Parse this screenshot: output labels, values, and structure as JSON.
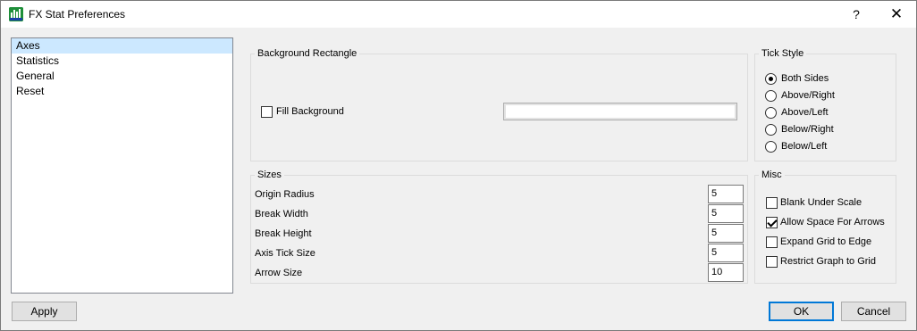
{
  "window": {
    "title": "FX Stat Preferences",
    "help_glyph": "?",
    "close_glyph": "✕"
  },
  "nav": {
    "items": [
      {
        "label": "Axes",
        "selected": true
      },
      {
        "label": "Statistics",
        "selected": false
      },
      {
        "label": "General",
        "selected": false
      },
      {
        "label": "Reset",
        "selected": false
      }
    ]
  },
  "background_rectangle": {
    "title": "Background Rectangle",
    "fill_label": "Fill Background",
    "fill_checked": false,
    "color_value": ""
  },
  "sizes": {
    "title": "Sizes",
    "rows": [
      {
        "label": "Origin Radius",
        "value": "5"
      },
      {
        "label": "Break Width",
        "value": "5"
      },
      {
        "label": "Break Height",
        "value": "5"
      },
      {
        "label": "Axis Tick Size",
        "value": "5"
      },
      {
        "label": "Arrow Size",
        "value": "10"
      }
    ]
  },
  "tick_style": {
    "title": "Tick Style",
    "options": [
      {
        "label": "Both Sides",
        "checked": true
      },
      {
        "label": "Above/Right",
        "checked": false
      },
      {
        "label": "Above/Left",
        "checked": false
      },
      {
        "label": "Below/Right",
        "checked": false
      },
      {
        "label": "Below/Left",
        "checked": false
      }
    ]
  },
  "misc": {
    "title": "Misc",
    "options": [
      {
        "label": "Blank Under Scale",
        "checked": false
      },
      {
        "label": "Allow Space For Arrows",
        "checked": true
      },
      {
        "label": "Expand Grid to Edge",
        "checked": false
      },
      {
        "label": "Restrict Graph to Grid",
        "checked": false
      }
    ]
  },
  "buttons": {
    "apply": "Apply",
    "ok": "OK",
    "cancel": "Cancel"
  },
  "colors": {
    "selection": "#cce8ff",
    "accent": "#0078d7",
    "icon": "#1f8f3a"
  }
}
